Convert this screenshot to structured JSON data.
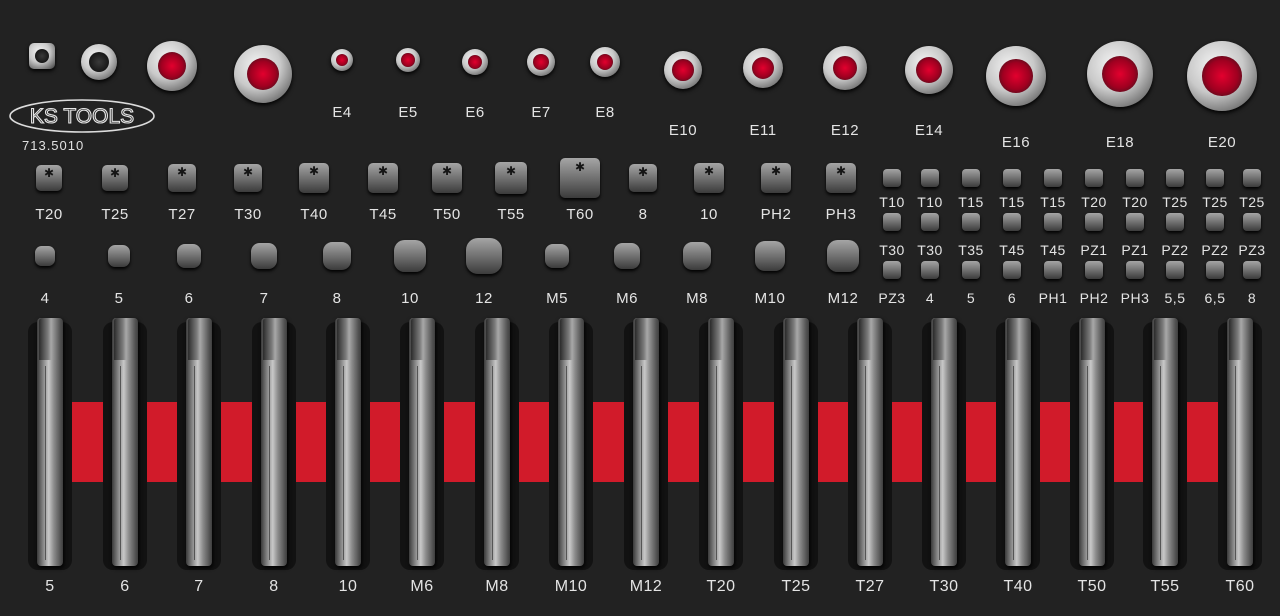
{
  "brand": {
    "logo_text": "KS TOOLS",
    "article_number": "713.5010"
  },
  "colors": {
    "foam": "#222222",
    "accent_red": "#d11b2a",
    "steel": "#b8b8b8"
  },
  "row1_socket_labels": [
    "E4",
    "E5",
    "E6",
    "E7",
    "E8",
    "E10",
    "E11",
    "E12",
    "E14",
    "E16",
    "E18",
    "E20"
  ],
  "row2_bit_labels": [
    "T20",
    "T25",
    "T27",
    "T30",
    "T40",
    "T45",
    "T50",
    "T55",
    "T60",
    "8",
    "10",
    "PH2",
    "PH3"
  ],
  "row2_small_labels": [
    "T10",
    "T10",
    "T15",
    "T15",
    "T15",
    "T20",
    "T20",
    "T25",
    "T25",
    "T25"
  ],
  "row3_bit_labels": [
    "4",
    "5",
    "6",
    "7",
    "8",
    "10",
    "12",
    "M5",
    "M6",
    "M8",
    "M10",
    "M12"
  ],
  "row3_small_labels": [
    "T30",
    "T30",
    "T35",
    "T45",
    "T45",
    "PZ1",
    "PZ1",
    "PZ2",
    "PZ2",
    "PZ3"
  ],
  "row4_small_labels": [
    "PZ3",
    "4",
    "5",
    "6",
    "PH1",
    "PH2",
    "PH3",
    "5,5",
    "6,5",
    "8"
  ],
  "long_bit_labels": [
    "5",
    "6",
    "7",
    "8",
    "10",
    "M6",
    "M8",
    "M10",
    "M12",
    "T20",
    "T25",
    "T27",
    "T30",
    "T40",
    "T50",
    "T55",
    "T60"
  ]
}
